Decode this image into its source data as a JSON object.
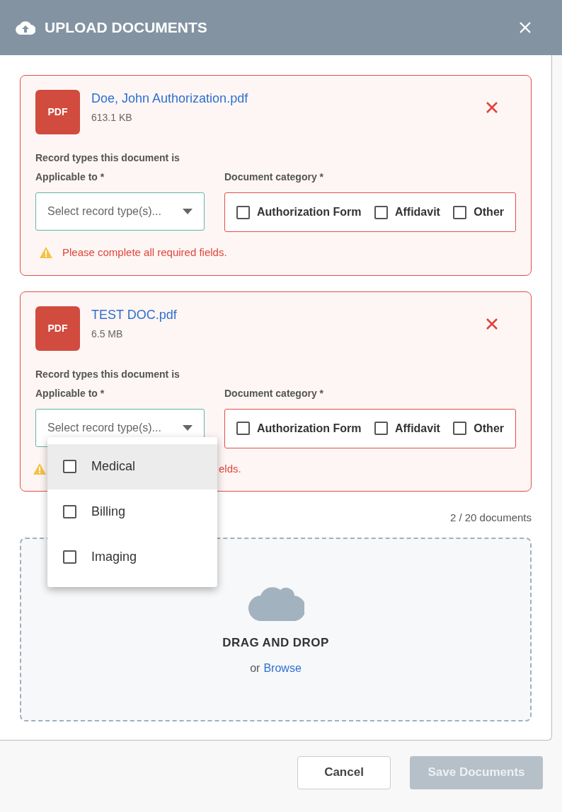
{
  "dialog": {
    "title": "UPLOAD DOCUMENTS"
  },
  "documents": [
    {
      "file_type": "PDF",
      "name": "Doe, John Authorization.pdf",
      "size": "613.1 KB",
      "record_label": "Record types this document is",
      "record_label_2": "Applicable to *",
      "select_placeholder": "Select record type(s)...",
      "category_label": "Document category *",
      "categories": [
        {
          "label": "Authorization Form",
          "checked": false
        },
        {
          "label": "Affidavit",
          "checked": false
        },
        {
          "label": "Other",
          "checked": false
        }
      ],
      "error": "Please complete all required fields.",
      "open": false
    },
    {
      "file_type": "PDF",
      "name": "TEST DOC.pdf",
      "size": "6.5 MB",
      "record_label": "Record types this document is",
      "record_label_2": "Applicable to *",
      "select_placeholder": "Select record type(s)...",
      "category_label": "Document category *",
      "categories": [
        {
          "label": "Authorization Form",
          "checked": false
        },
        {
          "label": "Affidavit",
          "checked": false
        },
        {
          "label": "Other",
          "checked": false
        }
      ],
      "error": "elds.",
      "open": true,
      "options": [
        {
          "label": "Medical",
          "checked": false,
          "highlighted": true
        },
        {
          "label": "Billing",
          "checked": false,
          "highlighted": false
        },
        {
          "label": "Imaging",
          "checked": false,
          "highlighted": false
        }
      ]
    }
  ],
  "count": "2 / 20 documents",
  "dropzone": {
    "title": "DRAG AND DROP",
    "or": "or",
    "link": "Browse"
  },
  "buttons": [
    {
      "label": "Cancel",
      "kind": "secondary",
      "disabled": false
    },
    {
      "label": "Save Documents",
      "kind": "primary",
      "disabled": true
    }
  ]
}
